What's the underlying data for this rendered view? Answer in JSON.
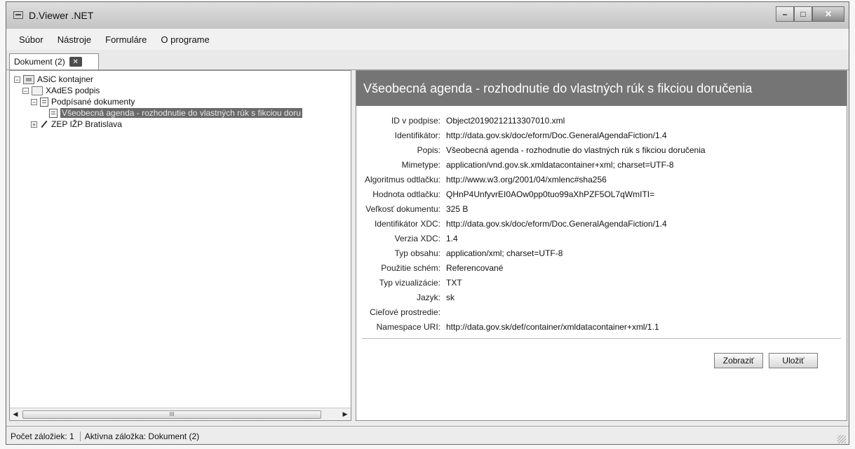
{
  "window": {
    "title": "D.Viewer .NET"
  },
  "menu": {
    "items": [
      "Súbor",
      "Nástroje",
      "Formuláre",
      "O programe"
    ]
  },
  "tabs": [
    {
      "label": "Dokument (2)"
    }
  ],
  "tree": {
    "root": "ASiC kontajner",
    "xades": "XAdES podpis",
    "signed_docs": "Podpísané dokumenty",
    "doc": "Všeobecná agenda - rozhodnutie do vlastných rúk s fikciou doru",
    "zep": "ZEP IŽP Bratislava"
  },
  "scrollbar": {
    "thumb": "III"
  },
  "detail": {
    "title": "Všeobecná agenda - rozhodnutie do vlastných rúk s fikciou doručenia",
    "properties": [
      {
        "label": "ID v podpise:",
        "value": "Object20190212113307010.xml"
      },
      {
        "label": "Identifikátor:",
        "value": "http://data.gov.sk/doc/eform/Doc.GeneralAgendaFiction/1.4"
      },
      {
        "label": "Popis:",
        "value": "Všeobecná agenda - rozhodnutie do vlastných rúk s fikciou doručenia"
      },
      {
        "label": "Mimetype:",
        "value": "application/vnd.gov.sk.xmldatacontainer+xml; charset=UTF-8"
      },
      {
        "label": "Algoritmus odtlačku:",
        "value": "http://www.w3.org/2001/04/xmlenc#sha256"
      },
      {
        "label": "Hodnota odtlačku:",
        "value": "QHnP4UnfyvrEI0AOw0pp0tuo99aXhPZF5OL7qWmITI="
      },
      {
        "label": "Veľkosť dokumentu:",
        "value": "325 B"
      },
      {
        "label": "Identifikátor XDC:",
        "value": "http://data.gov.sk/doc/eform/Doc.GeneralAgendaFiction/1.4"
      },
      {
        "label": "Verzia XDC:",
        "value": "1.4"
      },
      {
        "label": "Typ obsahu:",
        "value": "application/xml; charset=UTF-8"
      },
      {
        "label": "Použitie schém:",
        "value": "Referencované"
      },
      {
        "label": "Typ vizualizácie:",
        "value": "TXT"
      },
      {
        "label": "Jazyk:",
        "value": "sk"
      },
      {
        "label": "Cieľové prostredie:",
        "value": ""
      },
      {
        "label": "Namespace URI:",
        "value": "http://data.gov.sk/def/container/xmldatacontainer+xml/1.1"
      }
    ],
    "buttons": {
      "show": "Zobraziť",
      "save": "Uložiť"
    }
  },
  "status": {
    "count": "Počet záložiek: 1",
    "active": "Aktívna záložka: Dokument (2)"
  }
}
